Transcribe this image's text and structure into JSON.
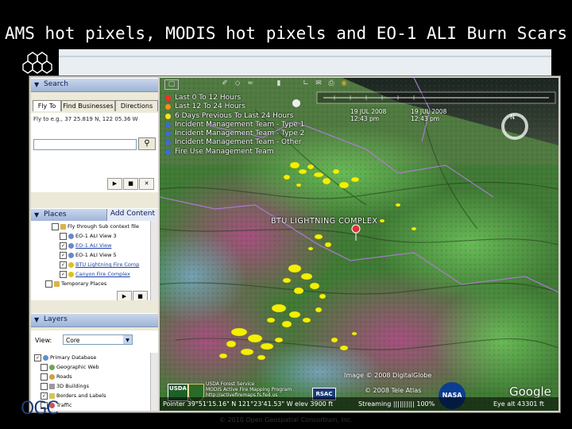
{
  "slide": {
    "title": "AMS hot pixels, MODIS hot pixels and EO-1 ALI Burn Scars",
    "footer": "© 2010 Open Geospatial Consortium, Inc.",
    "logo_text": "OGC"
  },
  "search_panel": {
    "header": "Search",
    "tabs": [
      "Fly To",
      "Find Businesses",
      "Directions"
    ],
    "hint": "Fly to e.g., 37 25.819 N, 122 05.36 W",
    "input_value": "",
    "go_icon": "search-icon"
  },
  "places_panel": {
    "header": "Places",
    "add_content": "Add Content",
    "items": [
      {
        "label": "Fly through Sub context file",
        "checked": false,
        "icon": "folder-icon"
      },
      {
        "label": "EO-1 ALI View 3",
        "checked": false,
        "icon": "link-icon"
      },
      {
        "label": "EO-1 ALI View",
        "checked": true,
        "icon": "link-icon"
      },
      {
        "label": "EO-1 ALI View 5",
        "checked": true,
        "icon": "link-icon"
      },
      {
        "label": "BTU Lightning Fire Comp",
        "checked": true,
        "icon": "fire-icon"
      },
      {
        "label": "Canyon Fire Complex",
        "checked": true,
        "icon": "fire-icon"
      },
      {
        "label": "Temporary Places",
        "checked": false,
        "icon": "folder-icon"
      }
    ]
  },
  "layers_panel": {
    "header": "Layers",
    "view_label": "View:",
    "view_value": "Core",
    "items": [
      {
        "label": "Primary Database",
        "checked": true
      },
      {
        "label": "Geographic Web",
        "checked": false
      },
      {
        "label": "Roads",
        "checked": false
      },
      {
        "label": "3D Buildings",
        "checked": false
      },
      {
        "label": "Borders and Labels",
        "checked": true
      },
      {
        "label": "Traffic",
        "checked": false
      }
    ]
  },
  "map": {
    "legend": [
      {
        "label": "Last 0 To 12 Hours",
        "color": "#ff2a2a"
      },
      {
        "label": "Last 12 To 24 Hours",
        "color": "#ff8c1a"
      },
      {
        "label": "6 Days Previous To Last 24 Hours",
        "color": "#ffe21a"
      },
      {
        "label": "Incident Management Team - Type 1",
        "color": "#3b6bd6"
      },
      {
        "label": "Incident Management Team - Type 2",
        "color": "#3b6bd6"
      },
      {
        "label": "Incident Management Team - Other",
        "color": "#3b6bd6"
      },
      {
        "label": "Fire Use Management Team",
        "color": "#3b6bd6"
      }
    ],
    "date_start": "19 JUL 2008",
    "time_start": "12:43 pm",
    "date_end": "19 JUL 2008",
    "time_end": "12:43 pm",
    "place_label": "BTU LIGHTNING COMPLEX",
    "credit_image": "Image © 2008 DigitalGlobe",
    "credit_atlas": "© 2008 Tele Atlas",
    "usfs_credit_line1": "USDA Forest Service",
    "usfs_credit_line2": "MODIS Active Fire Mapping Program",
    "usfs_credit_line3": "http://activefiremaps.fs.fed.us",
    "agency_usda": "USDA",
    "agency_rsac": "RSAC",
    "agency_nasa": "NASA",
    "brand": "Google",
    "compass_letter": "N",
    "status": {
      "pointer": "Pointer 39°51'15.16\" N 121°23'41.53\" W elev 3900 ft",
      "streaming": "Streaming |||||||||| 100%",
      "eye_alt": "Eye alt 43301 ft"
    }
  },
  "colors": {
    "panel_bg": "#ece9d8",
    "panel_header": "#b5c6e3",
    "fire_yellow": "#f4f000",
    "map_green": "#4f9a3e",
    "map_magenta": "#a2456e"
  }
}
